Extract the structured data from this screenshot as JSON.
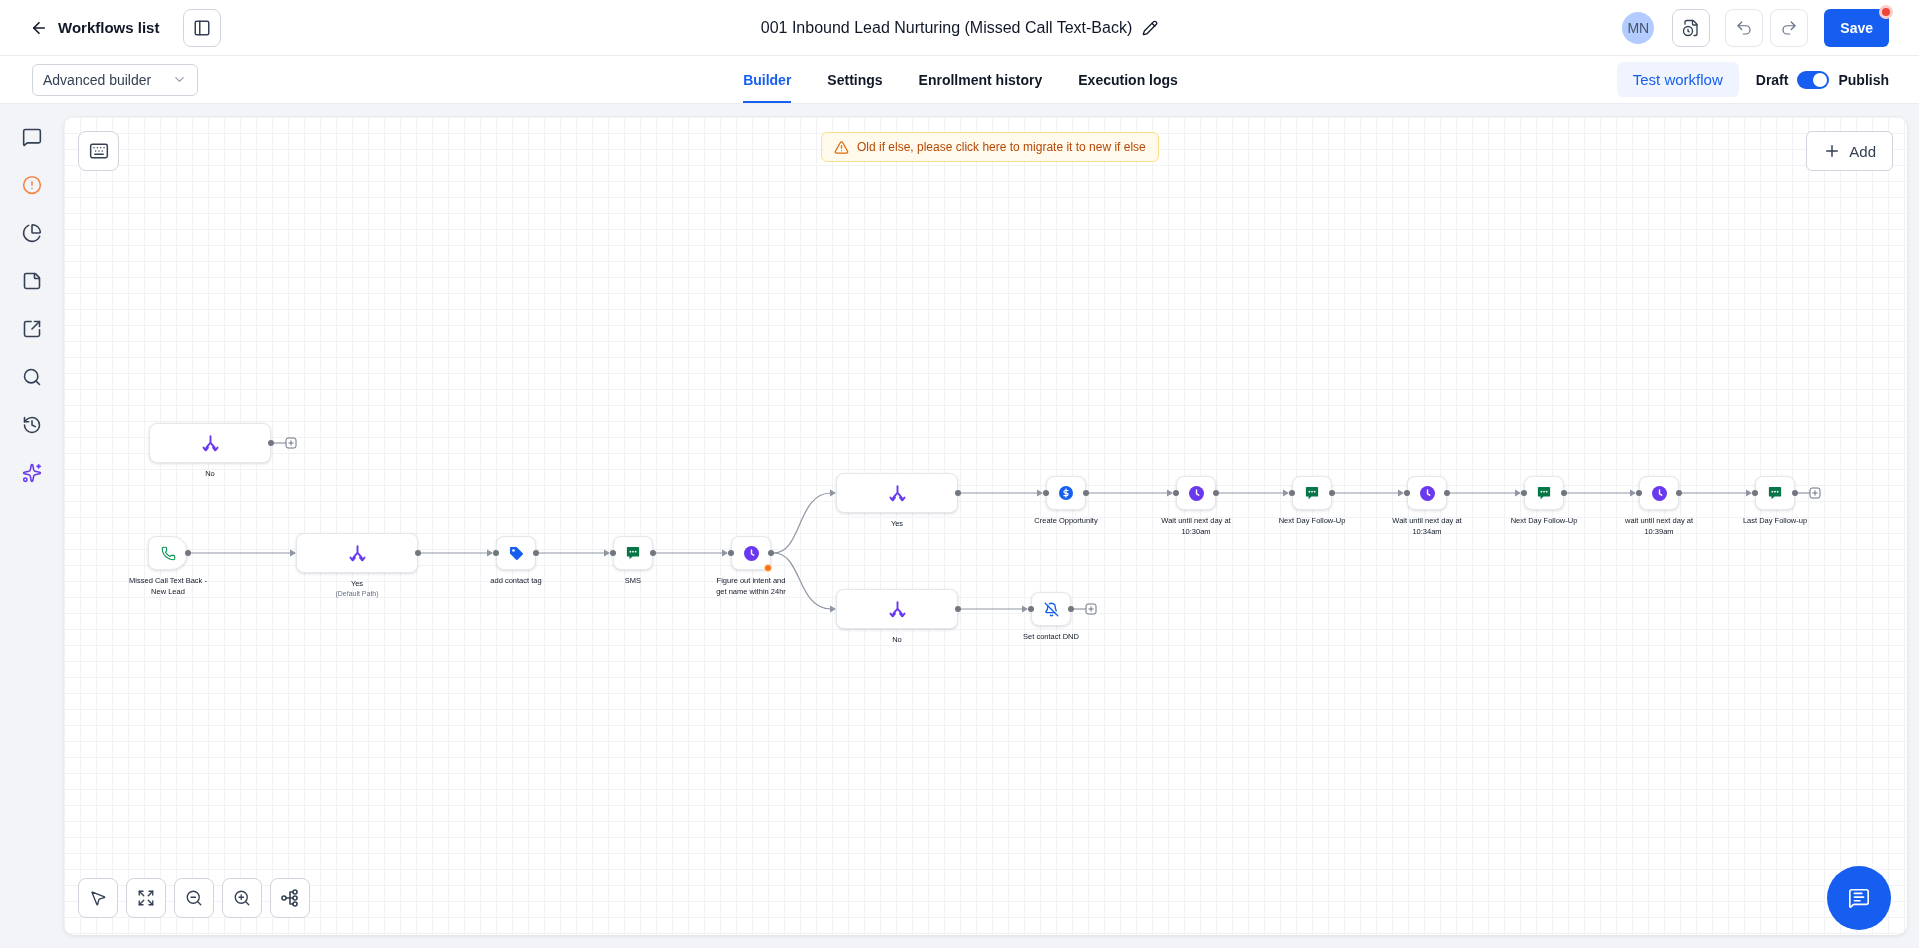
{
  "header": {
    "back_label": "Workflows list",
    "title": "001 Inbound Lead Nurturing (Missed Call Text-Back)",
    "avatar": "MN",
    "save_label": "Save",
    "unsaved": true
  },
  "toolbar": {
    "builder_mode": "Advanced builder",
    "tabs": [
      {
        "label": "Builder",
        "selected": true
      },
      {
        "label": "Settings",
        "selected": false
      },
      {
        "label": "Enrollment history",
        "selected": false
      },
      {
        "label": "Execution logs",
        "selected": false
      }
    ],
    "test_button": "Test workflow",
    "status_toggle": {
      "off_label": "Draft",
      "on_label": "Publish",
      "on": true
    }
  },
  "canvas": {
    "banner": "Old if else, please click here to migrate it to new if else",
    "add_label": "Add",
    "nodes": [
      {
        "kind": "condition",
        "label": "No",
        "warning": false
      },
      {
        "kind": "trigger",
        "label": "Missed Call Text Back - New Lead",
        "warning": false
      },
      {
        "kind": "condition",
        "label": "Yes",
        "note": "(Default Path)",
        "warning": false
      },
      {
        "kind": "tag",
        "label": "add contact tag",
        "warning": false
      },
      {
        "kind": "sms",
        "label": "SMS",
        "warning": false
      },
      {
        "kind": "wait",
        "label": "Figure out intent and get name within 24hr",
        "warning": true
      },
      {
        "kind": "condition",
        "label": "Yes",
        "warning": false
      },
      {
        "kind": "opportunity",
        "label": "Create Opportunity",
        "warning": false
      },
      {
        "kind": "wait",
        "label": "Wait until next day at 10:30am",
        "warning": false
      },
      {
        "kind": "sms",
        "label": "Next Day Follow-Up",
        "warning": false
      },
      {
        "kind": "wait",
        "label": "Wait until next day at 10:34am",
        "warning": false
      },
      {
        "kind": "sms",
        "label": "Next Day Follow-Up",
        "warning": false
      },
      {
        "kind": "wait",
        "label": "wait until next day at 10:39am",
        "warning": false
      },
      {
        "kind": "sms",
        "label": "Last Day Follow-up",
        "warning": false
      },
      {
        "kind": "condition",
        "label": "No",
        "warning": false
      },
      {
        "kind": "dnd",
        "label": "Set contact DND",
        "warning": false
      }
    ]
  }
}
